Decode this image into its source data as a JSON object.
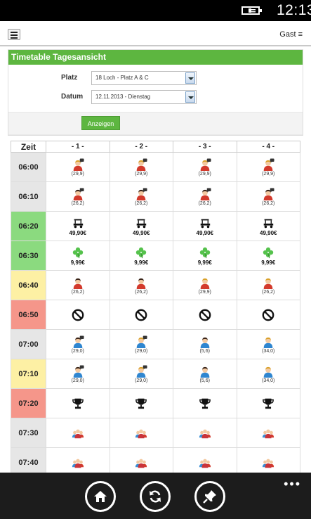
{
  "status": {
    "time": "12:13"
  },
  "header": {
    "user_label": "Gast"
  },
  "panel": {
    "title": "Timetable Tagesansicht",
    "platz_label": "Platz",
    "platz_value": "18 Loch - Platz A & C",
    "datum_label": "Datum",
    "datum_value": "12.11.2013 - Dienstag",
    "show_button": "Anzeigen"
  },
  "table": {
    "headers": [
      "Zeit",
      "- 1 -",
      "- 2 -",
      "- 3 -",
      "- 4 -"
    ],
    "rows": [
      {
        "time": "06:00",
        "color": "#e6e6e6",
        "cells": [
          {
            "icon": "woman-message-icon",
            "text": "(29,9)",
            "price": false
          },
          {
            "icon": "woman-message-icon",
            "text": "(29,9)",
            "price": false
          },
          {
            "icon": "woman-message-icon",
            "text": "(29,9)",
            "price": false
          },
          {
            "icon": "woman-message-icon",
            "text": "(29,9)",
            "price": false
          }
        ]
      },
      {
        "time": "06:10",
        "color": "#e6e6e6",
        "cells": [
          {
            "icon": "man-red-message-icon",
            "text": "(26,2)",
            "price": false
          },
          {
            "icon": "man-red-message-icon",
            "text": "(26,2)",
            "price": false
          },
          {
            "icon": "man-red-message-icon",
            "text": "(26,2)",
            "price": false
          },
          {
            "icon": "man-red-message-icon",
            "text": "(26,2)",
            "price": false
          }
        ]
      },
      {
        "time": "06:20",
        "color": "#8bda7f",
        "cells": [
          {
            "icon": "golf-cart-icon",
            "text": "49,90€",
            "price": true
          },
          {
            "icon": "golf-cart-icon",
            "text": "49,90€",
            "price": true
          },
          {
            "icon": "golf-cart-icon",
            "text": "49,90€",
            "price": true
          },
          {
            "icon": "golf-cart-icon",
            "text": "49,90€",
            "price": true
          }
        ]
      },
      {
        "time": "06:30",
        "color": "#8bda7f",
        "cells": [
          {
            "icon": "clover-icon",
            "text": "9,99€",
            "price": true
          },
          {
            "icon": "clover-icon",
            "text": "9,99€",
            "price": true
          },
          {
            "icon": "clover-icon",
            "text": "9,99€",
            "price": true
          },
          {
            "icon": "clover-icon",
            "text": "9,99€",
            "price": true
          }
        ]
      },
      {
        "time": "06:40",
        "color": "#fdf0a4",
        "cells": [
          {
            "icon": "man-red-icon",
            "text": "(26,2)",
            "price": false
          },
          {
            "icon": "man-red-icon",
            "text": "(26,2)",
            "price": false
          },
          {
            "icon": "woman-icon",
            "text": "(29,9)",
            "price": false
          },
          {
            "icon": "woman-icon",
            "text": "(26,2)",
            "price": false
          }
        ]
      },
      {
        "time": "06:50",
        "color": "#f5968a",
        "cells": [
          {
            "icon": "blocked-icon",
            "text": "",
            "price": false
          },
          {
            "icon": "blocked-icon",
            "text": "",
            "price": false
          },
          {
            "icon": "blocked-icon",
            "text": "",
            "price": false
          },
          {
            "icon": "blocked-icon",
            "text": "",
            "price": false
          }
        ]
      },
      {
        "time": "07:00",
        "color": "#e6e6e6",
        "cells": [
          {
            "icon": "man-blue-message-icon",
            "text": "(29,0)",
            "price": false
          },
          {
            "icon": "woman-blue-message-icon",
            "text": "(29,0)",
            "price": false
          },
          {
            "icon": "man-blue-icon",
            "text": "(5,6)",
            "price": false
          },
          {
            "icon": "woman-blue-icon",
            "text": "(34,0)",
            "price": false
          }
        ]
      },
      {
        "time": "07:10",
        "color": "#fdf0a4",
        "cells": [
          {
            "icon": "man-blue-message-icon",
            "text": "(29,0)",
            "price": false
          },
          {
            "icon": "woman-blue-message-icon",
            "text": "(29,0)",
            "price": false
          },
          {
            "icon": "man-blue-icon",
            "text": "(5,6)",
            "price": false
          },
          {
            "icon": "woman-blue-icon",
            "text": "(34,0)",
            "price": false
          }
        ]
      },
      {
        "time": "07:20",
        "color": "#f5968a",
        "cells": [
          {
            "icon": "trophy-icon",
            "text": "",
            "price": false
          },
          {
            "icon": "trophy-icon",
            "text": "",
            "price": false
          },
          {
            "icon": "trophy-icon",
            "text": "",
            "price": false
          },
          {
            "icon": "trophy-icon",
            "text": "",
            "price": false
          }
        ]
      },
      {
        "time": "07:30",
        "color": "#e6e6e6",
        "cells": [
          {
            "icon": "group-icon",
            "text": "",
            "price": false
          },
          {
            "icon": "group-icon",
            "text": "",
            "price": false
          },
          {
            "icon": "group-icon",
            "text": "",
            "price": false
          },
          {
            "icon": "group-icon",
            "text": "",
            "price": false
          }
        ]
      },
      {
        "time": "07:40",
        "color": "#e6e6e6",
        "cells": [
          {
            "icon": "group-icon",
            "text": "",
            "price": false
          },
          {
            "icon": "group-icon",
            "text": "",
            "price": false
          },
          {
            "icon": "group-icon",
            "text": "",
            "price": false
          },
          {
            "icon": "group-icon",
            "text": "",
            "price": false
          }
        ]
      }
    ]
  },
  "appbar": {
    "buttons": [
      {
        "name": "home-button",
        "icon": "home-icon"
      },
      {
        "name": "refresh-button",
        "icon": "refresh-icon"
      },
      {
        "name": "pin-button",
        "icon": "pin-icon"
      }
    ],
    "more": "•••"
  },
  "colors": {
    "accent": "#5db640",
    "free": "#e6e6e6",
    "green": "#8bda7f",
    "yellow": "#fdf0a4",
    "red": "#f5968a"
  }
}
